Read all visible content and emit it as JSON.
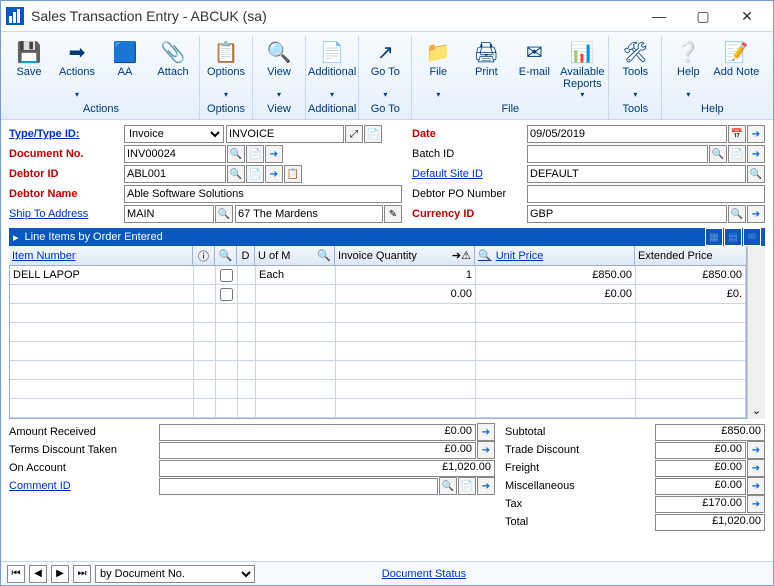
{
  "window": {
    "title": "Sales Transaction Entry  -  ABCUK (sa)"
  },
  "ribbon": {
    "groups": [
      {
        "label": "Actions",
        "buttons": [
          {
            "label": "Save",
            "dd": false,
            "glyph": "💾"
          },
          {
            "label": "Actions",
            "dd": true,
            "glyph": "➡"
          },
          {
            "label": "AA",
            "dd": false,
            "glyph": "🟦"
          },
          {
            "label": "Attach",
            "dd": false,
            "glyph": "📎"
          }
        ]
      },
      {
        "label": "Options",
        "buttons": [
          {
            "label": "Options",
            "dd": true,
            "glyph": "📋"
          }
        ]
      },
      {
        "label": "View",
        "buttons": [
          {
            "label": "View",
            "dd": true,
            "glyph": "🔍"
          }
        ]
      },
      {
        "label": "Additional",
        "buttons": [
          {
            "label": "Additional",
            "dd": true,
            "glyph": "📄"
          }
        ]
      },
      {
        "label": "Go To",
        "buttons": [
          {
            "label": "Go To",
            "dd": true,
            "glyph": "↗"
          }
        ]
      },
      {
        "label": "File",
        "buttons": [
          {
            "label": "File",
            "dd": true,
            "glyph": "📁"
          },
          {
            "label": "Print",
            "dd": false,
            "glyph": "🖨"
          },
          {
            "label": "E-mail",
            "dd": false,
            "glyph": "✉"
          },
          {
            "label": "Available Reports",
            "dd": true,
            "glyph": "📊"
          }
        ]
      },
      {
        "label": "Tools",
        "buttons": [
          {
            "label": "Tools",
            "dd": true,
            "glyph": "🛠"
          }
        ]
      },
      {
        "label": "Help",
        "buttons": [
          {
            "label": "Help",
            "dd": true,
            "glyph": "❔"
          },
          {
            "label": "Add Note",
            "dd": false,
            "glyph": "📝"
          }
        ]
      }
    ]
  },
  "form": {
    "left": {
      "type_label": "Type/Type ID:",
      "type_value": "Invoice",
      "type_id": "INVOICE",
      "docno_label": "Document No.",
      "docno_value": "INV00024",
      "debtorid_label": "Debtor ID",
      "debtorid_value": "ABL001",
      "debtorname_label": "Debtor Name",
      "debtorname_value": "Able Software Solutions",
      "shipto_label": "Ship To Address",
      "shipto_value": "MAIN",
      "shipto_addr": "67 The Mardens"
    },
    "right": {
      "date_label": "Date",
      "date_value": "09/05/2019",
      "batch_label": "Batch ID",
      "batch_value": "",
      "site_label": "Default Site ID",
      "site_value": "DEFAULT",
      "po_label": "Debtor PO Number",
      "po_value": "",
      "curr_label": "Currency ID",
      "curr_value": "GBP"
    }
  },
  "grid": {
    "title": "Line Items by Order Entered",
    "cols": {
      "item": "Item Number",
      "d": "D",
      "uom": "U of M",
      "qty": "Invoice Quantity",
      "price": "Unit Price",
      "ext": "Extended Price"
    },
    "rows": [
      {
        "item": "DELL LAPOP",
        "chk": false,
        "uom": "Each",
        "qty": "1",
        "price": "£850.00",
        "ext": "£850.00"
      },
      {
        "item": "",
        "chk": false,
        "uom": "",
        "qty": "0.00",
        "price": "£0.00",
        "ext": "£0."
      }
    ]
  },
  "totals_left": {
    "amtrecv_label": "Amount Received",
    "amtrecv_value": "£0.00",
    "terms_label": "Terms Discount Taken",
    "terms_value": "£0.00",
    "onacct_label": "On Account",
    "onacct_value": "£1,020.00",
    "comment_label": "Comment ID",
    "comment_value": ""
  },
  "totals_right": {
    "subtotal_label": "Subtotal",
    "subtotal_value": "£850.00",
    "trade_label": "Trade Discount",
    "trade_value": "£0.00",
    "freight_label": "Freight",
    "freight_value": "£0.00",
    "misc_label": "Miscellaneous",
    "misc_value": "£0.00",
    "tax_label": "Tax",
    "tax_value": "£170.00",
    "total_label": "Total",
    "total_value": "£1,020.00"
  },
  "status": {
    "nav_select": "by Document No.",
    "doc_status": "Document Status"
  }
}
